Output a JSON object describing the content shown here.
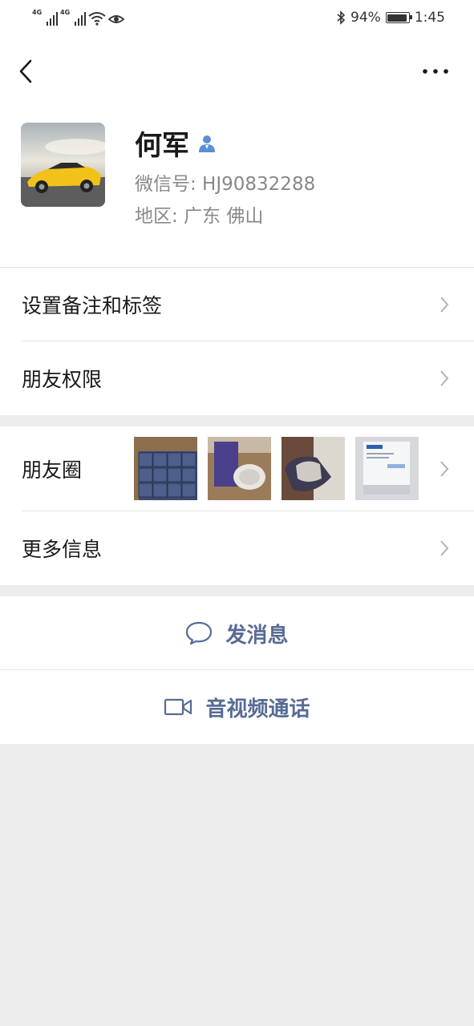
{
  "status_bar": {
    "signal_1_label": "4G",
    "signal_2_label": "4G",
    "battery_percent": "94%",
    "battery_level": 0.94,
    "time": "1:45"
  },
  "nav": {
    "back_icon": "chevron-left-icon",
    "more_icon": "more-dots-icon"
  },
  "profile": {
    "name": "何军",
    "wechat_id": "微信号: HJ90832288",
    "region": "地区: 广东  佛山"
  },
  "cells": {
    "remark_tags": "设置备注和标签",
    "friend_permissions": "朋友权限",
    "moments": "朋友圈",
    "more_info": "更多信息"
  },
  "actions": {
    "send_message": "发消息",
    "video_call": "音视频通话"
  },
  "colors": {
    "link_blue": "#576b95",
    "background": "#ededed",
    "separator": "#e5e5e5"
  }
}
